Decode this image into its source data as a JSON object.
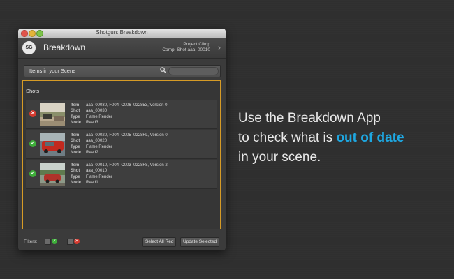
{
  "window": {
    "title": "Shotgun: Breakdown"
  },
  "header": {
    "logo_text": "SG",
    "title": "Breakdown",
    "context_line1": "Project Climp",
    "context_line2": "Comp, Shot aaa_00010",
    "chevron_icon": "chevron-right-icon"
  },
  "items_bar": {
    "label": "Items in your Scene",
    "search_icon": "search-icon",
    "search_value": ""
  },
  "list": {
    "section_label": "Shots",
    "rows": [
      {
        "status": "out-of-date",
        "status_glyph": "✕",
        "item_label": "Item",
        "item": "aaa_00030, F004_C006_022853, Version 0",
        "shot_label": "Shot",
        "shot": "aaa_00030",
        "type_label": "Type",
        "type": "Flame Render",
        "node_label": "Node",
        "node": "Read3"
      },
      {
        "status": "up-to-date",
        "status_glyph": "✓",
        "item_label": "Item",
        "item": "aaa_00020, F004_C005_0228FL, Version 0",
        "shot_label": "Shot",
        "shot": "aaa_00020",
        "type_label": "Type",
        "type": "Flame Render",
        "node_label": "Node",
        "node": "Read2"
      },
      {
        "status": "up-to-date",
        "status_glyph": "✓",
        "item_label": "Item",
        "item": "aaa_00010, F004_C003_0228F8, Version 2",
        "shot_label": "Shot",
        "shot": "aaa_00010",
        "type_label": "Type",
        "type": "Flame Render",
        "node_label": "Node",
        "node": "Read1"
      }
    ]
  },
  "footer": {
    "filters_label": "Filters:",
    "filter_ok_glyph": "✓",
    "filter_bad_glyph": "✕",
    "select_all_red": "Select All Red",
    "update_selected": "Update Selected"
  },
  "promo": {
    "line1": "Use the Breakdown App",
    "line2_prefix": "to check what is ",
    "line2_highlight": "out of date",
    "line3": "in your scene."
  },
  "colors": {
    "accent_blue": "#1ea7e1",
    "selection_orange": "#d69b26",
    "ok_green": "#3eae3a",
    "bad_red": "#d63a2f"
  }
}
